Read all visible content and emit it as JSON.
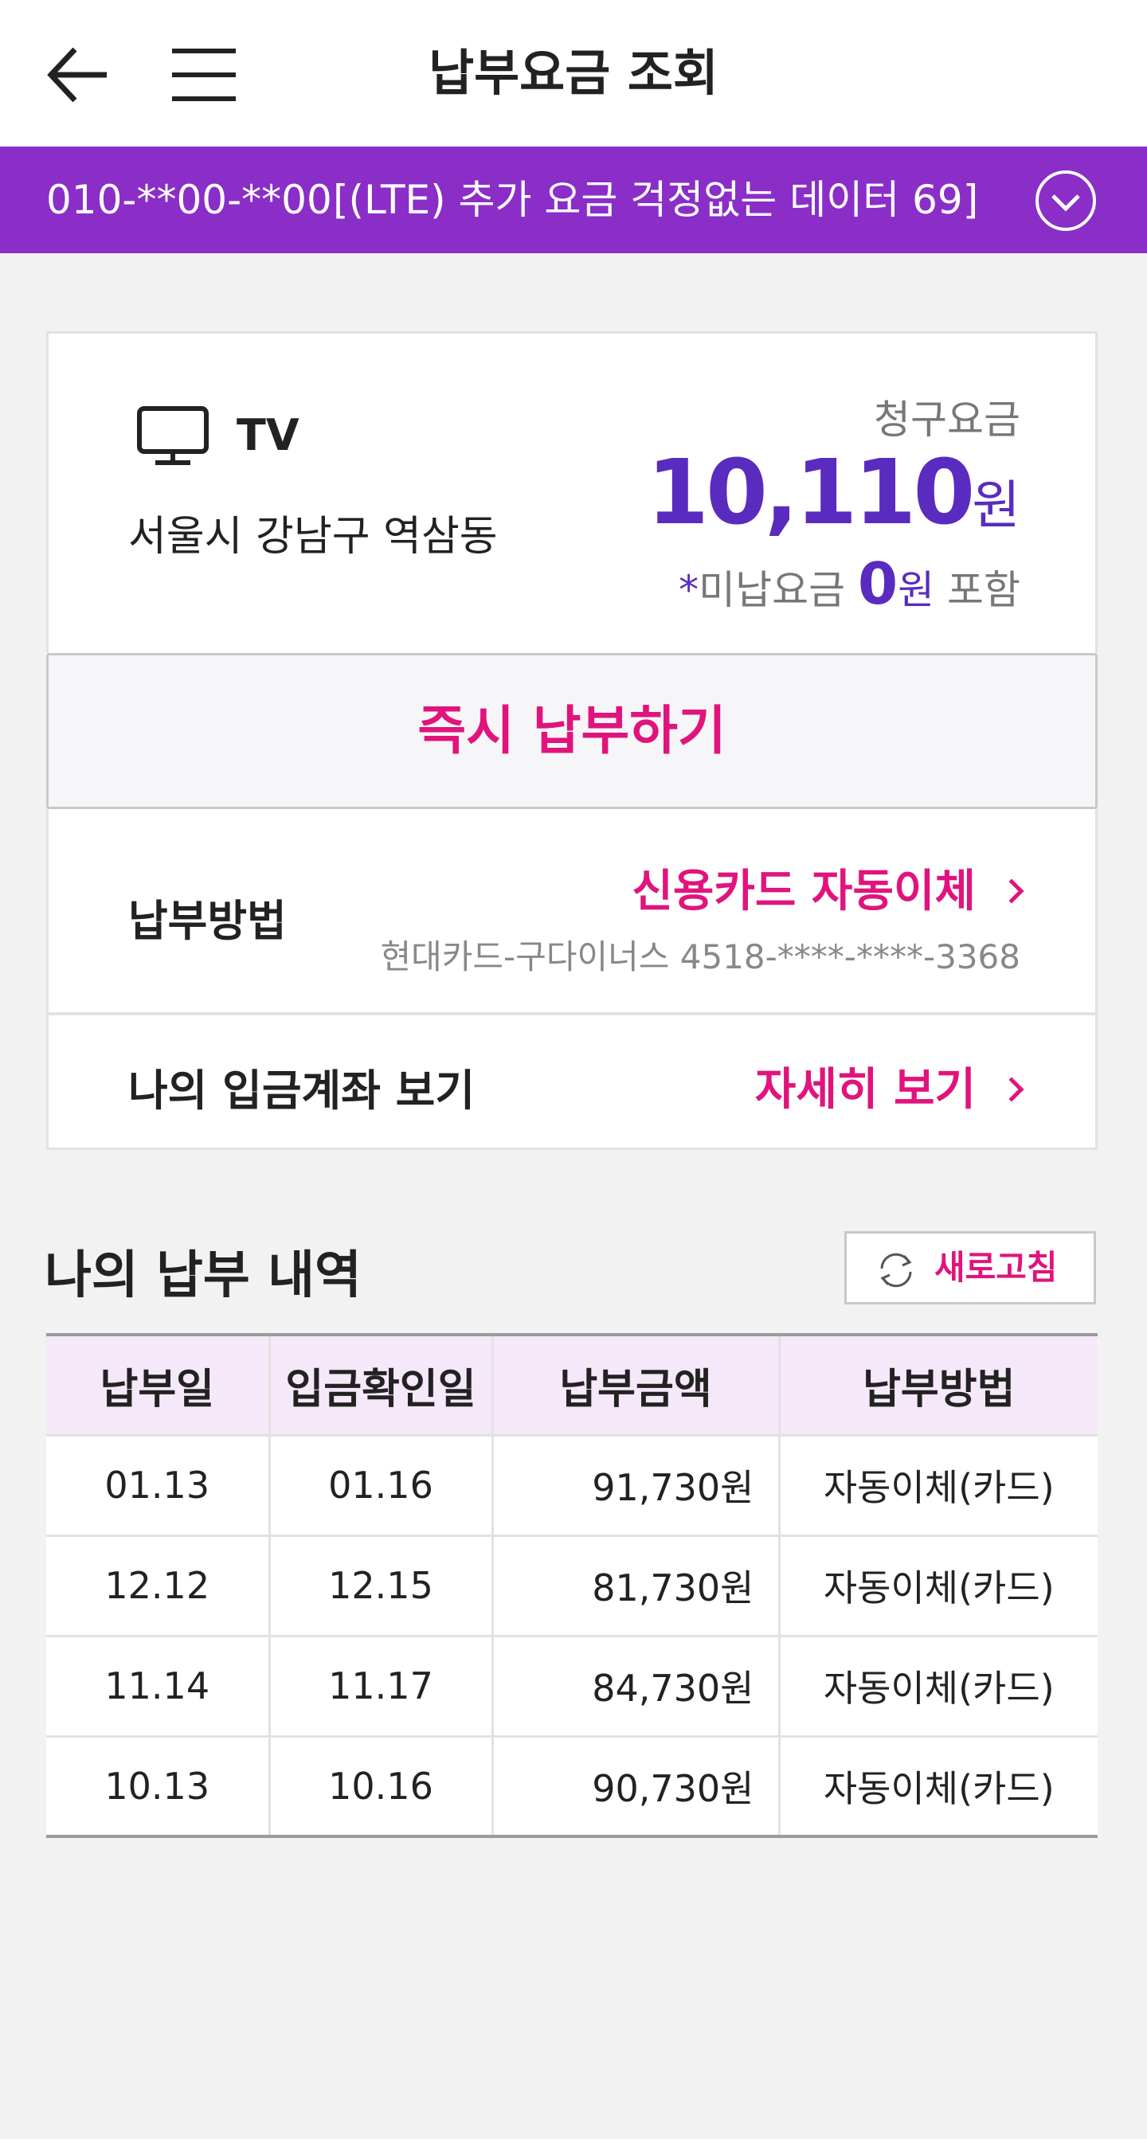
{
  "header": {
    "title": "납부요금 조회",
    "back_icon": "arrow-left-icon",
    "menu_icon": "hamburger-menu-icon"
  },
  "line": {
    "number": "010-**00-**00",
    "plan": "[(LTE) 추가 요금 걱정없는 데이터 69]",
    "toggle_icon": "chevron-down-circle-icon"
  },
  "bill": {
    "service_icon": "tv-monitor-icon",
    "service_type": "TV",
    "address": "서울시 강남구 역삼동",
    "label": "청구요금",
    "amount": "10,110",
    "currency": "원",
    "unpaid_prefix_star": "*",
    "unpaid_label": "미납요금",
    "unpaid_amount": "0",
    "unpaid_currency": "원",
    "unpaid_suffix": "포함"
  },
  "actions": {
    "pay_now": "즉시 납부하기"
  },
  "payment_method": {
    "label": "납부방법",
    "value": "신용카드 자동이체",
    "card_info": "현대카드-구다이너스 4518-****-****-3368"
  },
  "account": {
    "label": "나의 입금계좌 보기",
    "link": "자세히 보기"
  },
  "history": {
    "title": "나의 납부 내역",
    "refresh_label": "새로고침",
    "refresh_icon": "refresh-icon",
    "columns": [
      "납부일",
      "입금확인일",
      "납부금액",
      "납부방법"
    ],
    "rows": [
      [
        "01.13",
        "01.16",
        "91,730원",
        "자동이체(카드)"
      ],
      [
        "12.12",
        "12.15",
        "81,730원",
        "자동이체(카드)"
      ],
      [
        "11.14",
        "11.17",
        "84,730원",
        "자동이체(카드)"
      ],
      [
        "10.13",
        "10.16",
        "90,730원",
        "자동이체(카드)"
      ]
    ]
  },
  "colors": {
    "accent_purple": "#8a2ec7",
    "amount_purple": "#5a2bbf",
    "action_pink": "#e0147c",
    "table_header_bg": "#f5e8f9",
    "page_bg": "#f2f2f2"
  }
}
